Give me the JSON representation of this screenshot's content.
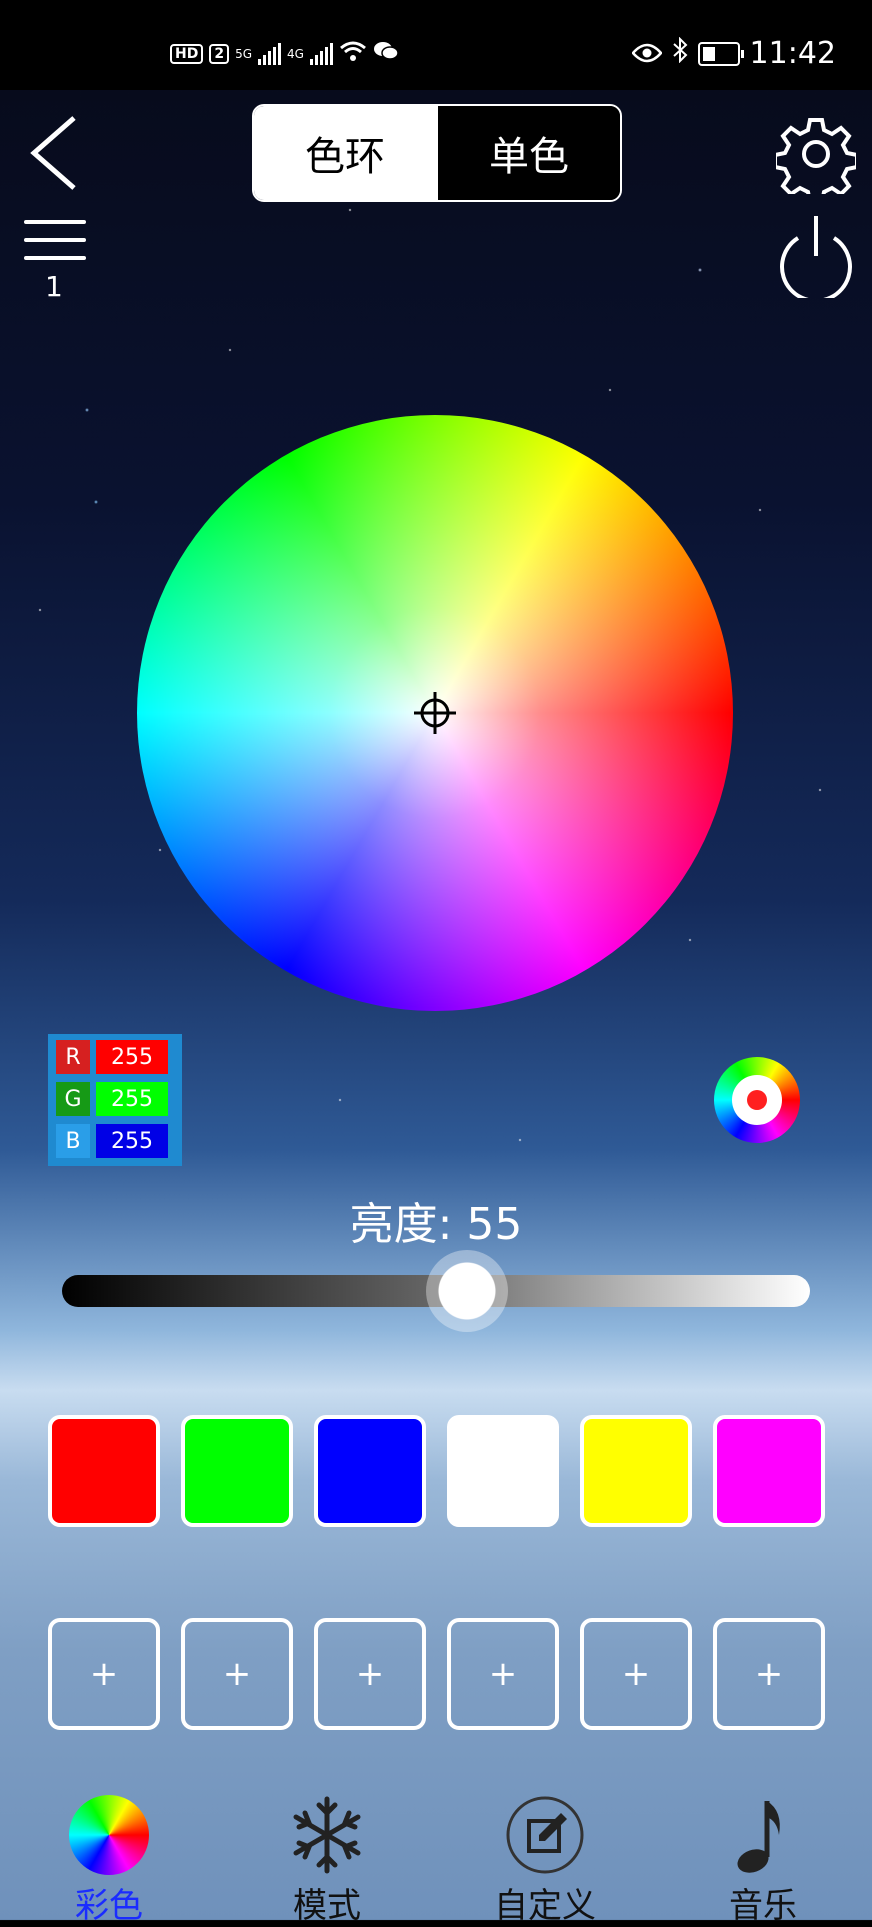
{
  "status_bar": {
    "left_badges": [
      "HD",
      "2",
      "5G",
      "4G"
    ],
    "time": "11:42",
    "icons": [
      "eye-icon",
      "bluetooth-icon",
      "battery-icon",
      "wifi-icon",
      "wechat-icon"
    ]
  },
  "header": {
    "tabs": [
      {
        "label": "色环",
        "active": true
      },
      {
        "label": "单色",
        "active": false
      }
    ],
    "menu_count": "1"
  },
  "rgb": [
    {
      "key": "R",
      "value": "255",
      "key_color": "#d62020",
      "value_color": "#ff0000"
    },
    {
      "key": "G",
      "value": "255",
      "key_color": "#169a16",
      "value_color": "#00ff00"
    },
    {
      "key": "B",
      "value": "255",
      "key_color": "#2a9ee8",
      "value_color": "#0000e6"
    }
  ],
  "brightness": {
    "label": "亮度: 55",
    "value": 55
  },
  "swatches": [
    "#ff0000",
    "#00ff00",
    "#0000ff",
    "#ffffff",
    "#ffff00",
    "#ff00ff"
  ],
  "custom_slots": [
    "+",
    "+",
    "+",
    "+",
    "+",
    "+"
  ],
  "bottom_nav": [
    {
      "label": "彩色",
      "icon": "color-wheel-icon",
      "active": true
    },
    {
      "label": "模式",
      "icon": "snowflake-icon",
      "active": false
    },
    {
      "label": "自定义",
      "icon": "edit-icon",
      "active": false
    },
    {
      "label": "音乐",
      "icon": "music-note-icon",
      "active": false
    }
  ]
}
